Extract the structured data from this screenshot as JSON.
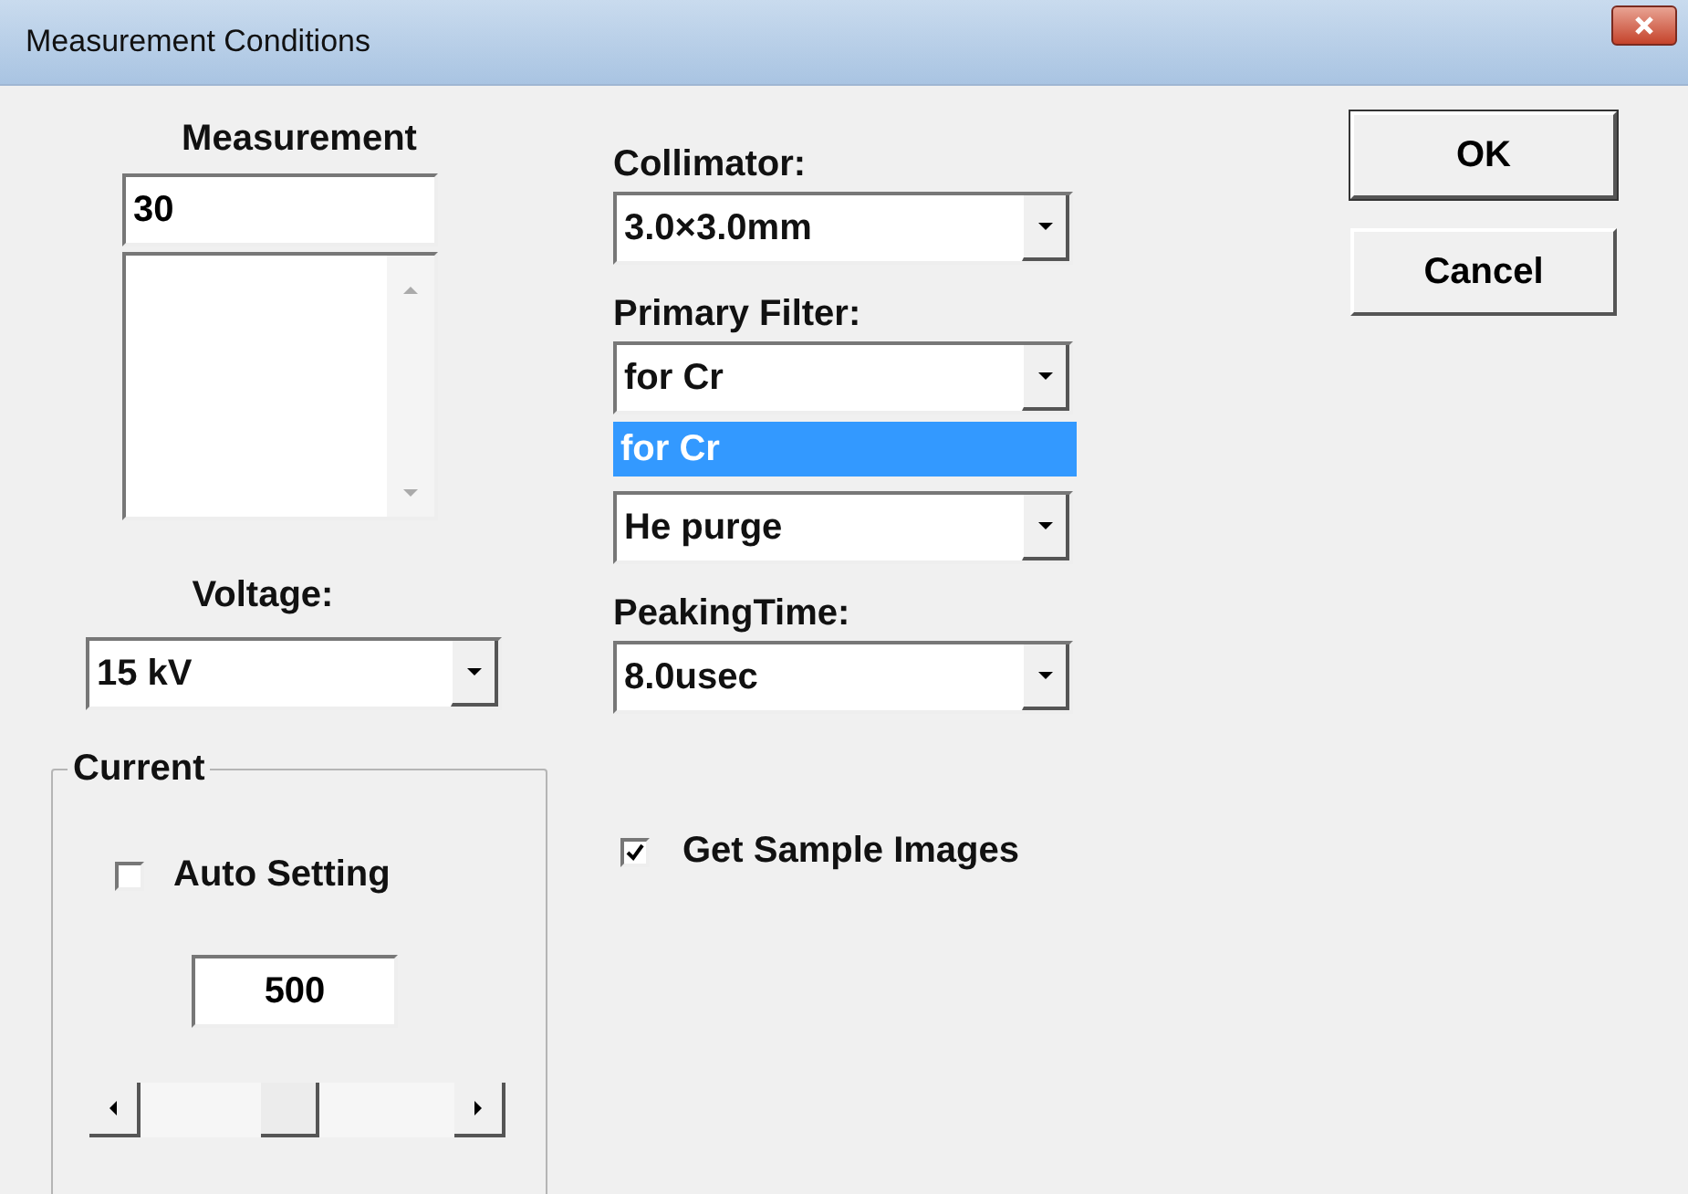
{
  "window": {
    "title": "Measurement Conditions"
  },
  "measurement": {
    "label": "Measurement",
    "value": "30"
  },
  "voltage": {
    "label": "Voltage:",
    "value": "15 kV"
  },
  "current": {
    "label": "Current",
    "auto_setting": {
      "label": "Auto Setting",
      "checked": false
    },
    "value": "500",
    "slider": {
      "level": 0.47
    }
  },
  "selects": [
    {
      "label": "Collimator:",
      "value": "3.0×3.0mm"
    },
    {
      "label": "Primary Filter:",
      "value": "for Cr",
      "options": [
        {
          "label": "for Cr",
          "selected": true
        }
      ]
    },
    {
      "value": "He purge"
    },
    {
      "label": "PeakingTime:",
      "value": "8.0usec"
    }
  ],
  "get_sample_images": {
    "label": "Get Sample Images",
    "checked": true
  },
  "buttons": [
    {
      "label": "OK",
      "default": true
    },
    {
      "label": "Cancel",
      "default": false
    }
  ]
}
